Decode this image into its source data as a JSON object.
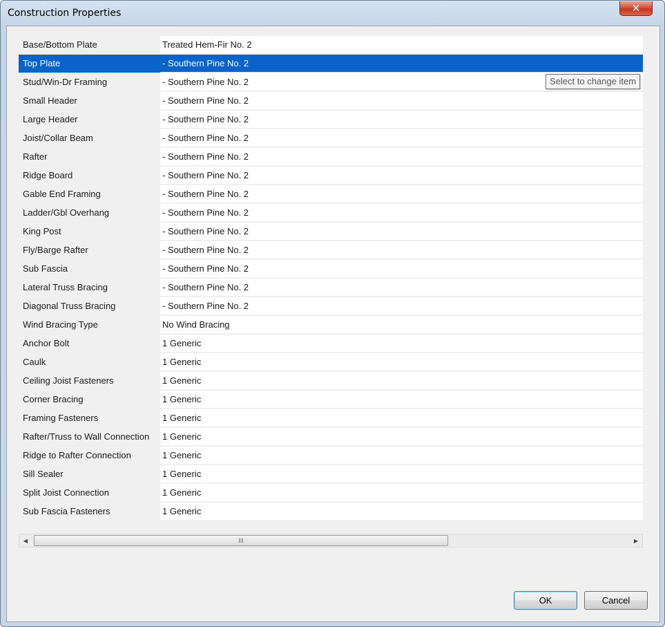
{
  "window": {
    "title": "Construction Properties",
    "close_glyph": "✕"
  },
  "properties": [
    {
      "label": "Base/Bottom Plate",
      "value": "Treated Hem-Fir No. 2"
    },
    {
      "label": "Top Plate",
      "value": "- Southern Pine No. 2",
      "selected": true
    },
    {
      "label": "Stud/Win-Dr Framing",
      "value": "- Southern Pine No. 2"
    },
    {
      "label": "Small Header",
      "value": "- Southern Pine No. 2"
    },
    {
      "label": "Large Header",
      "value": "- Southern Pine No. 2"
    },
    {
      "label": "Joist/Collar Beam",
      "value": "- Southern Pine No. 2"
    },
    {
      "label": "Rafter",
      "value": "- Southern Pine No. 2"
    },
    {
      "label": "Ridge Board",
      "value": "- Southern Pine No. 2"
    },
    {
      "label": "Gable End Framing",
      "value": "- Southern Pine No. 2"
    },
    {
      "label": "Ladder/Gbl Overhang",
      "value": "- Southern Pine No. 2"
    },
    {
      "label": "King Post",
      "value": "- Southern Pine No. 2"
    },
    {
      "label": "Fly/Barge Rafter",
      "value": "- Southern Pine No. 2"
    },
    {
      "label": "Sub Fascia",
      "value": "- Southern Pine No. 2"
    },
    {
      "label": "Lateral Truss Bracing",
      "value": "- Southern Pine No. 2"
    },
    {
      "label": "Diagonal Truss Bracing",
      "value": "- Southern Pine No. 2"
    },
    {
      "label": "Wind Bracing Type",
      "value": "No Wind Bracing"
    },
    {
      "label": "Anchor Bolt",
      "value": "1 Generic"
    },
    {
      "label": "Caulk",
      "value": "1 Generic"
    },
    {
      "label": "Ceiling Joist Fasteners",
      "value": "1 Generic"
    },
    {
      "label": "Corner Bracing",
      "value": "1 Generic"
    },
    {
      "label": "Framing Fasteners",
      "value": "1 Generic"
    },
    {
      "label": "Rafter/Truss to Wall Connection",
      "value": "1 Generic"
    },
    {
      "label": "Ridge to Rafter Connection",
      "value": "1 Generic"
    },
    {
      "label": "Sill Sealer",
      "value": "1 Generic"
    },
    {
      "label": "Split Joist Connection",
      "value": "1 Generic"
    },
    {
      "label": "Sub Fascia Fasteners",
      "value": "1 Generic"
    }
  ],
  "tooltip": {
    "text": "Select to change item"
  },
  "scrollbar": {
    "left_glyph": "◀",
    "right_glyph": "▶",
    "thumb_grip": "III"
  },
  "buttons": {
    "ok_label": "OK",
    "cancel_label": "Cancel"
  },
  "colors": {
    "selection": "#0a63c9",
    "close_button": "#c5361e"
  }
}
